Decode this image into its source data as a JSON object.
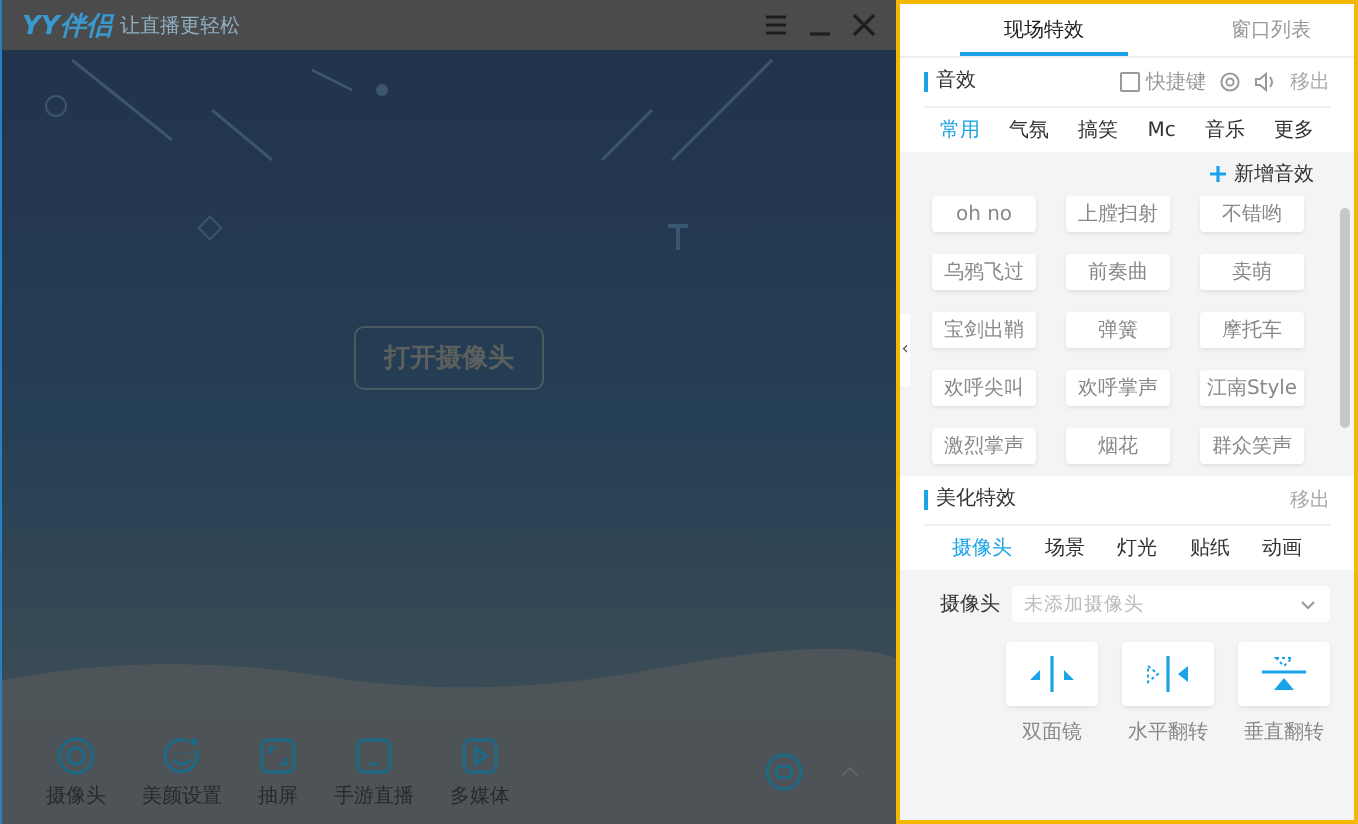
{
  "window": {
    "logo": "YY伴侣",
    "slogan": "让直播更轻松"
  },
  "open_camera_button": "打开摄像头",
  "toolbar": [
    {
      "label": "摄像头",
      "kind": "camera"
    },
    {
      "label": "美颜设置",
      "kind": "beauty"
    },
    {
      "label": "抽屏",
      "kind": "screen"
    },
    {
      "label": "手游直播",
      "kind": "phone"
    },
    {
      "label": "多媒体",
      "kind": "media"
    }
  ],
  "panel_tabs": [
    {
      "label": "现场特效",
      "selected": true
    },
    {
      "label": "窗口列表",
      "selected": false
    }
  ],
  "sound": {
    "title": "音效",
    "hotkey": {
      "label": "快捷键",
      "checked": false
    },
    "remove": "移出",
    "categories": [
      {
        "label": "常用",
        "selected": true
      },
      {
        "label": "气氛",
        "selected": false
      },
      {
        "label": "搞笑",
        "selected": false
      },
      {
        "label": "Mc",
        "selected": false
      },
      {
        "label": "音乐",
        "selected": false
      },
      {
        "label": "更多",
        "selected": false
      }
    ],
    "add_button": "新增音效",
    "effects": [
      "oh no",
      "上膛扫射",
      "不错哟",
      "乌鸦飞过",
      "前奏曲",
      "卖萌",
      "宝剑出鞘",
      "弹簧",
      "摩托车",
      "欢呼尖叫",
      "欢呼掌声",
      "江南Style",
      "激烈掌声",
      "烟花",
      "群众笑声"
    ]
  },
  "collapse_handle": "‹",
  "beauty": {
    "title": "美化特效",
    "remove": "移出",
    "tabs": [
      {
        "label": "摄像头",
        "selected": true
      },
      {
        "label": "场景",
        "selected": false
      },
      {
        "label": "灯光",
        "selected": false
      },
      {
        "label": "贴纸",
        "selected": false
      },
      {
        "label": "动画",
        "selected": false
      }
    ],
    "camera": {
      "label": "摄像头",
      "placeholder": "未添加摄像头"
    },
    "tools": [
      {
        "label": "双面镜",
        "kind": "mirror"
      },
      {
        "label": "水平翻转",
        "kind": "hflip"
      },
      {
        "label": "垂直翻转",
        "kind": "vflip"
      }
    ]
  }
}
